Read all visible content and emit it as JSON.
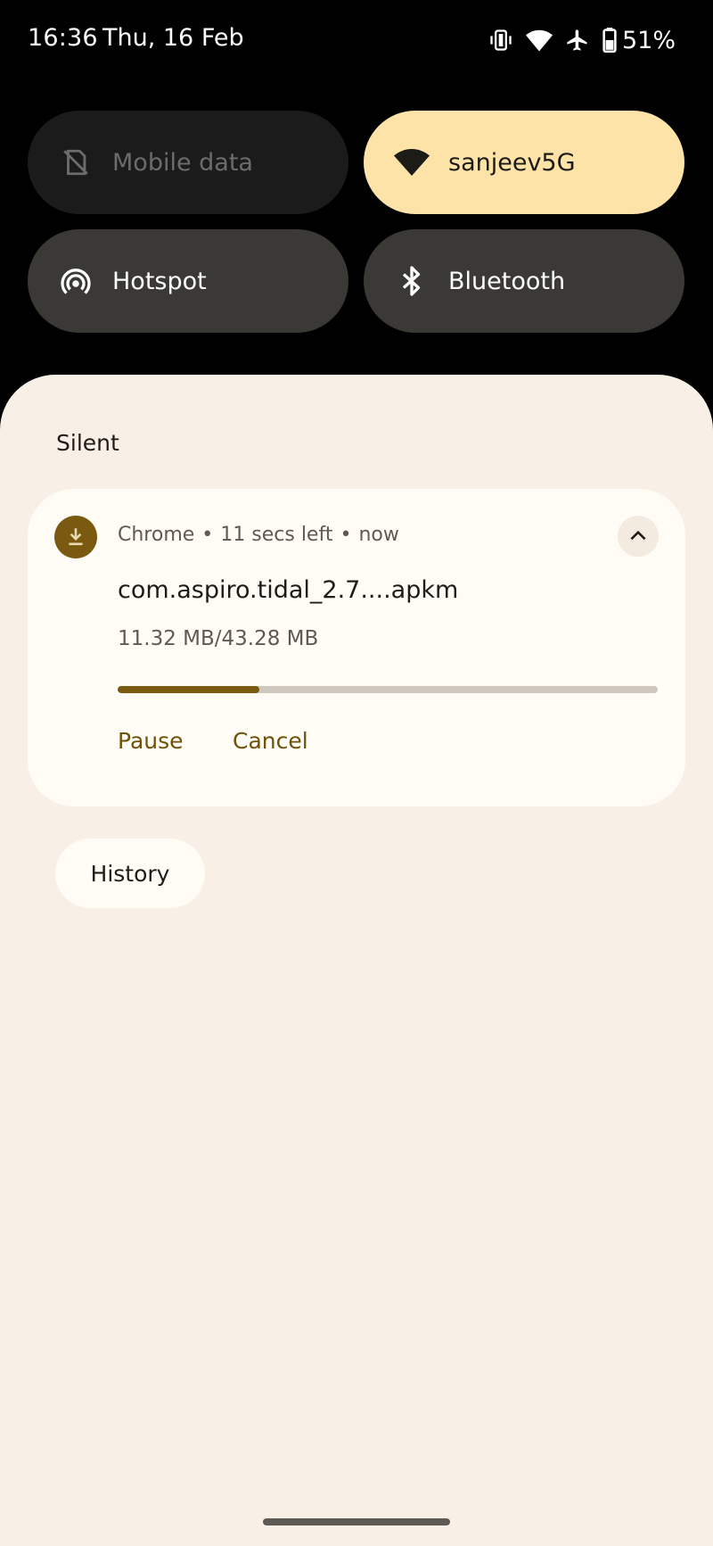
{
  "status_bar": {
    "time": "16:36",
    "date": "Thu, 16 Feb",
    "battery_percent": "51%",
    "icons": [
      "vibrate-icon",
      "wifi-icon",
      "airplane-icon",
      "battery-icon"
    ]
  },
  "quick_settings": {
    "tiles": [
      {
        "label": "Mobile data",
        "icon": "mobile-data-off-icon",
        "active": false
      },
      {
        "label": "sanjeev5G",
        "icon": "wifi-icon",
        "active": true
      },
      {
        "label": "Hotspot",
        "icon": "hotspot-icon",
        "active": false
      },
      {
        "label": "Bluetooth",
        "icon": "bluetooth-icon",
        "active": false
      }
    ]
  },
  "shade": {
    "section_title": "Silent",
    "notification": {
      "app_name": "Chrome",
      "time_left": "11 secs left",
      "timestamp": "now",
      "separator": "•",
      "title": "com.aspiro.tidal_2.7....apkm",
      "size_text": "11.32 MB/43.28 MB",
      "progress_fraction": 0.2616,
      "actions": {
        "pause": "Pause",
        "cancel": "Cancel"
      }
    },
    "history_label": "History"
  },
  "colors": {
    "accent": "#7a5a10",
    "wifi_tile": "#fde3a8",
    "shade_bg": "#f8efe6",
    "card_bg": "#fffbf5"
  }
}
